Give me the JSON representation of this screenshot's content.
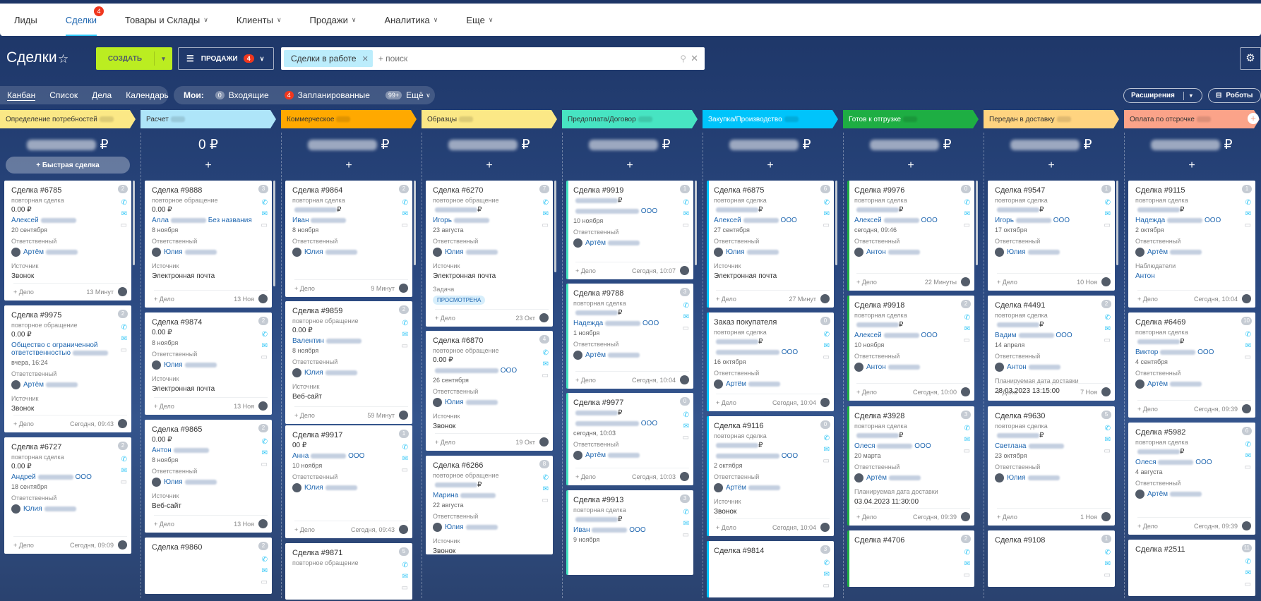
{
  "nav": [
    {
      "label": "Лиды",
      "chev": false
    },
    {
      "label": "Сделки",
      "active": true,
      "badge": "4",
      "chev": false
    },
    {
      "label": "Товары и Склады",
      "chev": true
    },
    {
      "label": "Клиенты",
      "chev": true
    },
    {
      "label": "Продажи",
      "chev": true
    },
    {
      "label": "Аналитика",
      "chev": true
    },
    {
      "label": "Еще",
      "chev": true
    }
  ],
  "toolbar": {
    "title": "Сделки",
    "create": "СОЗДАТЬ",
    "sales": "ПРОДАЖИ",
    "sales_badge": "4",
    "chip": "Сделки в работе",
    "search_placeholder": "+ поиск"
  },
  "views": {
    "items": [
      "Канбан",
      "Список",
      "Дела",
      "Календарь"
    ],
    "mine": "Мои:",
    "incoming_count": "0",
    "incoming": "Входящие",
    "planned_count": "4",
    "planned": "Запланированные",
    "more_count": "99+",
    "more": "Ещё",
    "extensions": "Расширения",
    "robots": "Роботы"
  },
  "columns": [
    {
      "title": "Определение потребностей",
      "color": "#fbe886",
      "sum": "₽",
      "quick": "+ Быстрая сделка"
    },
    {
      "title": "Расчет",
      "color": "#aee5f9",
      "sum": "0 ₽"
    },
    {
      "title": "Коммерческое",
      "color": "#ffa900",
      "sum": "₽"
    },
    {
      "title": "Образцы",
      "color": "#fbe886",
      "sum": "₽"
    },
    {
      "title": "Предоплата/Договор",
      "color": "#47e4c2",
      "sum": "₽"
    },
    {
      "title": "Закупка/Производство",
      "color": "#00c4fb",
      "sum": "₽"
    },
    {
      "title": "Готов к отгрузке",
      "color": "#1eae43",
      "sum": "₽"
    },
    {
      "title": "Передан в доставку",
      "color": "#ffd480",
      "sum": "₽"
    },
    {
      "title": "Оплата по отсрочке",
      "color": "#fba389",
      "sum": "₽"
    }
  ],
  "labels": {
    "resp": "Ответственный",
    "source": "Источник",
    "task": "Задача",
    "delo": "+ Дело",
    "observers": "Наблюдатели",
    "planned_delivery": "Планируемая дата доставки",
    "repeat_deal": "повторная сделка",
    "repeat_req": "повторное обращение",
    "viewed": "ПРОСМОТРЕНА"
  },
  "cards": [
    [
      {
        "title": "Сделка #6785",
        "num": "2",
        "sub": "повторная сделка",
        "amount": "0.00 ₽",
        "link": "Алексей",
        "date": "20 сентября",
        "resp": "Артём",
        "source": "Звонок",
        "time": "13 Минут"
      },
      {
        "title": "Сделка #9975",
        "num": "2",
        "sub": "повторное обращение",
        "amount": "0.00 ₽",
        "link": "Общество с ограниченной ответственностью",
        "date": "вчера, 16:24",
        "resp": "Артём",
        "source": "Звонок",
        "time": "Сегодня, 09:43"
      },
      {
        "title": "Сделка #6727",
        "num": "2",
        "sub": "повторная сделка",
        "amount": "0.00 ₽",
        "link": "Андрей",
        "link2": "ООО",
        "date": "18 сентября",
        "resp": "Юлия",
        "time": "Сегодня, 09:09"
      }
    ],
    [
      {
        "title": "Сделка #9888",
        "num": "3",
        "sub": "повторное обращение",
        "amount": "0.00 ₽",
        "link": "Алла",
        "link2": "Без названия",
        "date": "8 ноября",
        "resp": "Юлия",
        "source": "Электронная почта",
        "time": "13 Ноя"
      },
      {
        "title": "Сделка #9874",
        "num": "2",
        "amount": "0.00 ₽",
        "date": "8 ноября",
        "resp": "Юлия",
        "source": "Электронная почта",
        "time": "13 Ноя"
      },
      {
        "title": "Сделка #9865",
        "num": "2",
        "amount": "0.00 ₽",
        "link": "Антон",
        "date": "8 ноября",
        "resp": "Юлия",
        "source": "Веб-сайт",
        "time": "13 Ноя"
      },
      {
        "title": "Сделка #9860",
        "num": "2"
      }
    ],
    [
      {
        "title": "Сделка #9864",
        "num": "2",
        "sub": "повторная сделка",
        "amount": "₽",
        "link": "Иван",
        "date": "8 ноября",
        "resp": "Юлия",
        "time": "9 Минут"
      },
      {
        "title": "Сделка #9859",
        "num": "2",
        "sub": "повторное обращение",
        "amount": "0.00 ₽",
        "link": "Валентин",
        "date": "8 ноября",
        "resp": "Юлия",
        "source": "Веб-сайт",
        "time": "59 Минут"
      },
      {
        "title": "Сделка #9917",
        "num": "1",
        "amount": "00 ₽",
        "link": "Анна",
        "link2": "ООО",
        "date": "10 ноября",
        "resp": "Юлия",
        "time": "Сегодня, 09:43"
      },
      {
        "title": "Сделка #9871",
        "num": "5",
        "sub": "повторное обращение"
      }
    ],
    [
      {
        "title": "Сделка #6270",
        "num": "7",
        "sub": "повторное обращение",
        "amount": "₽",
        "link": "Игорь",
        "date": "23 августа",
        "resp": "Юлия",
        "source": "Электронная почта",
        "task": true,
        "time": "23 Окт"
      },
      {
        "title": "Сделка #6870",
        "num": "4",
        "sub": "повторное обращение",
        "amount": "0.00 ₽",
        "link2": "ООО",
        "date": "26 сентября",
        "resp": "Юлия",
        "source": "Звонок",
        "time": "19 Окт"
      },
      {
        "title": "Сделка #6266",
        "num": "8",
        "sub": "повторное обращение",
        "amount": "₽",
        "link": "Марина",
        "date": "22 августа",
        "resp": "Юлия",
        "source": "Звонок"
      }
    ],
    [
      {
        "title": "Сделка #9919",
        "num": "1",
        "amount": "₽",
        "link2": "ООО",
        "date": "10 ноября",
        "resp": "Артём",
        "time": "Сегодня, 10:07"
      },
      {
        "title": "Сделка #9788",
        "num": "3",
        "sub": "повторная сделка",
        "amount": "₽",
        "link": "Надежда",
        "link2": "ООО",
        "date": "1 ноября",
        "resp": "Артём",
        "time": "Сегодня, 10:04"
      },
      {
        "title": "Сделка #9977",
        "num": "0",
        "amount": "₽",
        "link2": "ООО",
        "date": "сегодня, 10:03",
        "resp": "Артём",
        "time": "Сегодня, 10:03"
      },
      {
        "title": "Сделка #9913",
        "num": "3",
        "sub": "повторная сделка",
        "amount": "₽",
        "link": "Иван",
        "link2": "ООО",
        "date": "9 ноября"
      }
    ],
    [
      {
        "title": "Сделка #6875",
        "num": "6",
        "sub": "повторная сделка",
        "amount": "₽",
        "link": "Алексей",
        "link2": "ООО",
        "date": "27 сентября",
        "resp": "Юлия",
        "source": "Электронная почта",
        "time": "27 Минут"
      },
      {
        "title": "Заказ покупателя",
        "num": "0",
        "sub": "повторная сделка",
        "amount": "₽",
        "link2": "ООО",
        "date": "16 октября",
        "resp": "Артём",
        "time": "Сегодня, 10:04"
      },
      {
        "title": "Сделка #9116",
        "num": "0",
        "sub": "повторная сделка",
        "amount": "₽",
        "link2": "ООО",
        "date": "2 октября",
        "resp": "Артём",
        "source": "Звонок",
        "time": "Сегодня, 10:04"
      },
      {
        "title": "Сделка #9814",
        "num": "3"
      }
    ],
    [
      {
        "title": "Сделка #9976",
        "num": "0",
        "sub": "повторная сделка",
        "amount": "₽",
        "link": "Алексей",
        "link2": "ООО",
        "date": "сегодня, 09:46",
        "resp": "Антон",
        "time": "22 Минуты"
      },
      {
        "title": "Сделка #9918",
        "num": "2",
        "sub": "повторная сделка",
        "amount": "₽",
        "link": "Алексей",
        "link2": "ООО",
        "date": "10 ноября",
        "resp": "Антон",
        "time": "Сегодня, 10:00"
      },
      {
        "title": "Сделка #3928",
        "num": "3",
        "sub": "повторная сделка",
        "amount": "₽",
        "link": "Олеся",
        "link2": "ООО",
        "date": "20 марта",
        "resp": "Артём",
        "planned": "03.04.2023 11:30:00",
        "time": "Сегодня, 09:39"
      },
      {
        "title": "Сделка #4706",
        "num": "2"
      }
    ],
    [
      {
        "title": "Сделка #9547",
        "num": "1",
        "sub": "повторная сделка",
        "amount": "₽",
        "link": "Игорь",
        "link2": "ООО",
        "date": "17 октября",
        "resp": "Юлия",
        "time": "10 Ноя"
      },
      {
        "title": "Сделка #4491",
        "num": "2",
        "sub": "повторная сделка",
        "amount": "₽",
        "link": "Вадим",
        "link2": "ООО",
        "date": "14 апреля",
        "resp": "Антон",
        "planned": "28.03.2023 13:15:00",
        "time": "7 Ноя"
      },
      {
        "title": "Сделка #9630",
        "num": "5",
        "sub": "повторная сделка",
        "amount": "₽",
        "link": "Светлана",
        "date": "23 октября",
        "resp": "Юлия",
        "time": "1 Ноя"
      },
      {
        "title": "Сделка #9108",
        "num": "1"
      }
    ],
    [
      {
        "title": "Сделка #9115",
        "num": "1",
        "sub": "повторная сделка",
        "amount": "₽",
        "link": "Надежда",
        "link2": "ООО",
        "date": "2 октября",
        "resp": "Артём",
        "observers": "Антон",
        "time": "Сегодня, 10:04"
      },
      {
        "title": "Сделка #6469",
        "num": "10",
        "sub": "повторная сделка",
        "amount": "₽",
        "link": "Виктор",
        "link2": "ООО",
        "date": "4 сентября",
        "resp": "Артём",
        "time": "Сегодня, 09:39"
      },
      {
        "title": "Сделка #5982",
        "num": "6",
        "sub": "повторная сделка",
        "amount": "₽",
        "link": "Олеся",
        "link2": "ООО",
        "date": "4 августа",
        "resp": "Артём",
        "time": "Сегодня, 09:39"
      },
      {
        "title": "Сделка #2511",
        "num": "11"
      }
    ]
  ]
}
